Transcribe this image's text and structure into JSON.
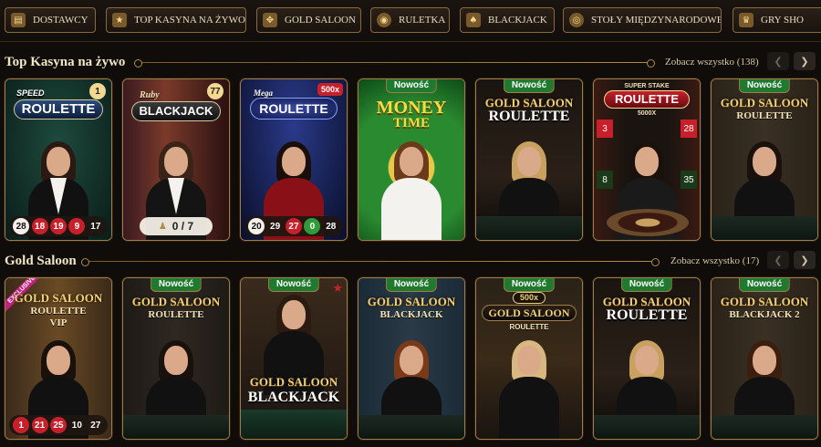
{
  "nav": {
    "items": [
      {
        "label": "DOSTAWCY",
        "icon": "providers-icon"
      },
      {
        "label": "TOP KASYNA NA ŻYWO",
        "icon": "star-icon"
      },
      {
        "label": "GOLD SALOON",
        "icon": "saloon-icon"
      },
      {
        "label": "RULETKA",
        "icon": "roulette-icon"
      },
      {
        "label": "BLACKJACK",
        "icon": "cards-icon"
      },
      {
        "label": "STOŁY MIĘDZYNARODOWE",
        "icon": "globe-icon"
      },
      {
        "label": "GRY SHO",
        "icon": "mic-icon"
      }
    ]
  },
  "sections": [
    {
      "title": "Top Kasyna na żywo",
      "see_all": "Zobacz wszystko (138)",
      "tiles": [
        {
          "title_top": "SPEED",
          "title": "ROULETTE",
          "corner": "1",
          "results": [
            "28",
            "18",
            "19",
            "9",
            "17"
          ],
          "result_colors": [
            "black",
            "red",
            "red",
            "red",
            "plain"
          ]
        },
        {
          "title_top": "Ruby",
          "title": "BLACKJACK",
          "corner": "77",
          "seats": "0 / 7"
        },
        {
          "title_top": "Mega",
          "title": "ROULETTE",
          "corner": "500x",
          "results": [
            "20",
            "29",
            "27",
            "0",
            "28"
          ],
          "result_colors": [
            "black",
            "plain",
            "red",
            "green",
            "plain"
          ]
        },
        {
          "badge": "Nowość",
          "title": "MONEY",
          "title2": "TIME"
        },
        {
          "badge": "Nowość",
          "title": "GOLD SALOON",
          "title2": "ROULETTE"
        },
        {
          "title_top": "SUPER STAKE",
          "title": "ROULETTE",
          "subtitle": "5000X",
          "side_numbers": [
            "3",
            "28",
            "8",
            "35"
          ]
        },
        {
          "badge": "Nowość",
          "title": "GOLD SALOON",
          "title2": "ROULETTE"
        }
      ]
    },
    {
      "title": "Gold Saloon",
      "see_all": "Zobacz wszystko (17)",
      "tiles": [
        {
          "ribbon": "EXCLUSIVE",
          "title": "GOLD SALOON",
          "title2": "ROULETTE",
          "title3": "VIP",
          "results": [
            "1",
            "21",
            "25",
            "10",
            "27"
          ],
          "result_colors": [
            "red",
            "red",
            "red",
            "plain",
            "plain"
          ]
        },
        {
          "badge": "Nowość",
          "title": "GOLD SALOON",
          "title2": "ROULETTE"
        },
        {
          "badge": "Nowość",
          "title": "GOLD SALOON",
          "title2": "BLACKJACK"
        },
        {
          "badge": "Nowość",
          "title": "GOLD SALOON",
          "title2": "BLACKJACK"
        },
        {
          "badge": "Nowość",
          "title_top": "500x",
          "title": "GOLD SALOON",
          "title2": "ROULETTE"
        },
        {
          "badge": "Nowość",
          "title": "GOLD SALOON",
          "title2": "ROULETTE"
        },
        {
          "badge": "Nowość",
          "title": "GOLD SALOON",
          "title2": "BLACKJACK 2"
        }
      ]
    }
  ],
  "colors": {
    "accent_gold": "#b08a48",
    "badge_green": "#1f7a2f",
    "red": "#c8202a",
    "green": "#2f9b3a"
  }
}
